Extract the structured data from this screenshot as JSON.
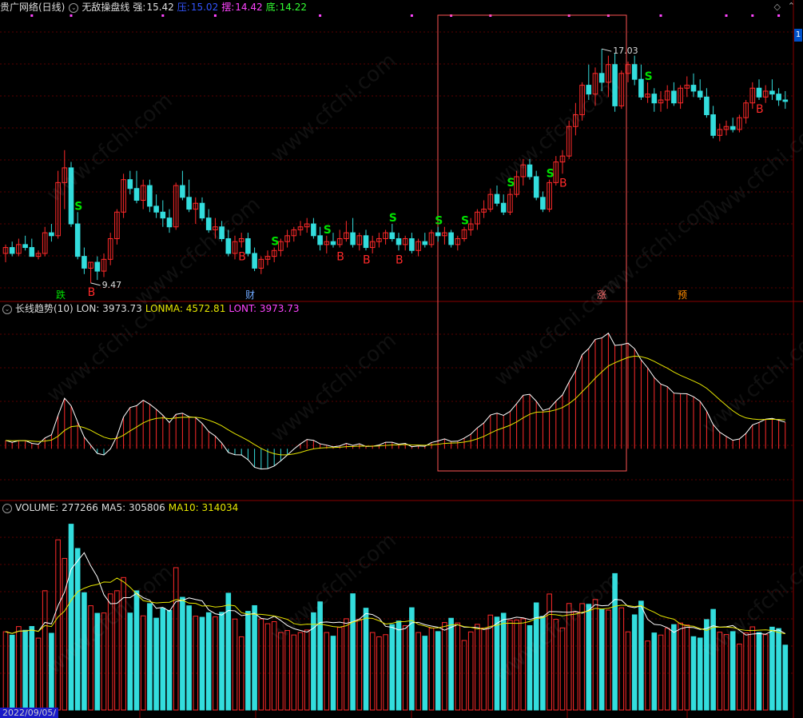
{
  "main_header": {
    "app": "贵广网络(日线)",
    "indicator": "无敌操盘线",
    "strong_label": "强:",
    "strong_value": "15.42",
    "press_label": "压:",
    "press_value": "15.02",
    "swing_label": "摆:",
    "swing_value": "14.42",
    "bottom_label": "底:",
    "bottom_value": "14.22"
  },
  "trend_header": {
    "name": "长线趋势(10)",
    "lon": "LON: 3973.73",
    "lonma": "LONMA: 4572.81",
    "lont": "LONT: 3973.73"
  },
  "volume_header": {
    "name": "VOLUME: 277266",
    "ma5": "MA5: 305806",
    "ma10": "MA10: 314034"
  },
  "date_label": "2022/09/05/",
  "page_indicator": "1",
  "colors": {
    "up": "#ff2a2a",
    "down": "#33dddd",
    "signal_s": "#00e000",
    "signal_b": "#ff2a2a",
    "ma_white": "#ffffff",
    "ma_yellow": "#e6e600",
    "lont": "#ff44ff",
    "press": "#3355ff",
    "grid": "#5a0000"
  },
  "watermark_text": "www.cfchi.com",
  "chart_data": {
    "type": "candlestick",
    "price": {
      "ylim": [
        8.5,
        18.2
      ],
      "ohlc": [
        [
          10.1,
          10.4,
          9.8,
          10.3
        ],
        [
          10.3,
          10.5,
          10.0,
          10.1
        ],
        [
          10.1,
          10.6,
          10.0,
          10.4
        ],
        [
          10.4,
          10.7,
          10.2,
          10.3
        ],
        [
          10.3,
          10.6,
          10.1,
          10.0
        ],
        [
          10.0,
          10.2,
          9.9,
          10.1
        ],
        [
          10.1,
          11.0,
          10.0,
          10.8
        ],
        [
          10.8,
          11.1,
          10.5,
          10.7
        ],
        [
          10.7,
          12.9,
          10.6,
          12.5
        ],
        [
          12.5,
          13.6,
          11.6,
          13.0
        ],
        [
          13.0,
          13.2,
          11.0,
          11.1
        ],
        [
          11.1,
          11.5,
          9.9,
          10.0
        ],
        [
          10.0,
          10.3,
          9.4,
          9.6
        ],
        [
          9.6,
          9.8,
          9.1,
          9.8
        ],
        [
          9.8,
          10.0,
          9.2,
          9.5
        ],
        [
          9.5,
          10.1,
          9.3,
          9.9
        ],
        [
          9.9,
          10.8,
          9.7,
          10.6
        ],
        [
          10.6,
          11.6,
          10.4,
          11.5
        ],
        [
          11.5,
          12.8,
          11.3,
          12.6
        ],
        [
          12.6,
          12.9,
          12.1,
          12.3
        ],
        [
          12.3,
          12.9,
          11.8,
          11.9
        ],
        [
          11.9,
          12.6,
          11.6,
          12.4
        ],
        [
          12.4,
          12.6,
          11.5,
          11.7
        ],
        [
          11.7,
          12.1,
          11.3,
          11.5
        ],
        [
          11.5,
          11.9,
          11.0,
          11.3
        ],
        [
          11.3,
          11.6,
          10.8,
          11.0
        ],
        [
          11.0,
          12.5,
          10.9,
          12.4
        ],
        [
          12.4,
          12.9,
          11.9,
          12.0
        ],
        [
          12.0,
          12.6,
          11.5,
          11.6
        ],
        [
          11.6,
          12.0,
          11.1,
          11.8
        ],
        [
          11.8,
          12.0,
          11.2,
          11.3
        ],
        [
          11.3,
          11.6,
          10.8,
          10.9
        ],
        [
          10.9,
          11.3,
          10.6,
          11.0
        ],
        [
          11.0,
          11.2,
          10.5,
          10.6
        ],
        [
          10.6,
          10.9,
          10.0,
          10.1
        ],
        [
          10.1,
          10.7,
          9.9,
          10.5
        ],
        [
          10.5,
          10.8,
          10.3,
          10.6
        ],
        [
          10.6,
          10.8,
          10.0,
          10.1
        ],
        [
          10.1,
          10.3,
          9.5,
          9.6
        ],
        [
          9.6,
          10.0,
          9.4,
          9.9
        ],
        [
          9.9,
          10.2,
          9.7,
          10.0
        ],
        [
          10.0,
          10.3,
          9.8,
          10.2
        ],
        [
          10.2,
          10.6,
          10.0,
          10.5
        ],
        [
          10.5,
          10.9,
          10.3,
          10.7
        ],
        [
          10.7,
          11.0,
          10.5,
          10.9
        ],
        [
          10.9,
          11.2,
          10.7,
          11.0
        ],
        [
          11.0,
          11.3,
          10.8,
          11.1
        ],
        [
          11.1,
          11.3,
          10.6,
          10.7
        ],
        [
          10.7,
          11.0,
          10.2,
          10.4
        ],
        [
          10.4,
          10.7,
          10.1,
          10.5
        ],
        [
          10.5,
          10.8,
          10.3,
          10.4
        ],
        [
          10.4,
          10.9,
          10.3,
          10.6
        ],
        [
          10.6,
          11.2,
          10.5,
          10.8
        ],
        [
          10.8,
          11.3,
          10.3,
          10.4
        ],
        [
          10.4,
          10.8,
          10.2,
          10.7
        ],
        [
          10.7,
          10.9,
          10.2,
          10.3
        ],
        [
          10.3,
          10.7,
          10.1,
          10.5
        ],
        [
          10.5,
          10.8,
          10.3,
          10.6
        ],
        [
          10.6,
          10.9,
          10.4,
          10.8
        ],
        [
          10.8,
          11.1,
          10.5,
          10.6
        ],
        [
          10.6,
          10.8,
          10.2,
          10.4
        ],
        [
          10.4,
          10.7,
          10.2,
          10.6
        ],
        [
          10.6,
          10.8,
          10.1,
          10.2
        ],
        [
          10.2,
          10.6,
          10.0,
          10.5
        ],
        [
          10.5,
          10.8,
          10.3,
          10.4
        ],
        [
          10.4,
          10.9,
          10.3,
          10.8
        ],
        [
          10.8,
          11.0,
          10.5,
          10.7
        ],
        [
          10.7,
          11.0,
          10.4,
          10.8
        ],
        [
          10.8,
          10.9,
          10.3,
          10.4
        ],
        [
          10.4,
          10.7,
          10.2,
          10.6
        ],
        [
          10.6,
          11.0,
          10.5,
          10.9
        ],
        [
          10.9,
          11.3,
          10.7,
          11.1
        ],
        [
          11.1,
          11.6,
          10.9,
          11.5
        ],
        [
          11.5,
          11.9,
          11.3,
          11.6
        ],
        [
          11.6,
          12.3,
          11.5,
          12.1
        ],
        [
          12.1,
          12.4,
          11.7,
          11.8
        ],
        [
          11.8,
          12.1,
          11.4,
          11.5
        ],
        [
          11.5,
          12.3,
          11.4,
          12.1
        ],
        [
          12.1,
          12.9,
          12.0,
          12.7
        ],
        [
          12.7,
          13.3,
          12.4,
          13.1
        ],
        [
          13.1,
          13.3,
          12.6,
          12.7
        ],
        [
          12.7,
          12.9,
          11.9,
          12.0
        ],
        [
          12.0,
          12.2,
          11.5,
          11.6
        ],
        [
          11.6,
          12.6,
          11.5,
          12.5
        ],
        [
          12.5,
          13.4,
          12.4,
          13.2
        ],
        [
          13.2,
          13.6,
          12.8,
          13.4
        ],
        [
          13.4,
          14.6,
          13.3,
          14.4
        ],
        [
          14.4,
          15.2,
          14.1,
          14.8
        ],
        [
          14.8,
          15.9,
          14.6,
          15.8
        ],
        [
          15.8,
          16.5,
          15.3,
          15.5
        ],
        [
          15.5,
          16.4,
          15.1,
          16.2
        ],
        [
          16.2,
          17.03,
          15.6,
          15.9
        ],
        [
          15.9,
          16.8,
          15.4,
          16.5
        ],
        [
          16.5,
          16.9,
          14.9,
          15.1
        ],
        [
          15.1,
          16.3,
          15.0,
          16.2
        ],
        [
          16.2,
          16.6,
          15.9,
          16.5
        ],
        [
          16.5,
          16.8,
          15.8,
          16.0
        ],
        [
          16.0,
          16.5,
          15.3,
          15.4
        ],
        [
          15.4,
          15.9,
          15.2,
          15.5
        ],
        [
          15.5,
          15.7,
          14.9,
          15.2
        ],
        [
          15.2,
          15.6,
          14.9,
          15.3
        ],
        [
          15.3,
          15.8,
          15.0,
          15.6
        ],
        [
          15.6,
          15.9,
          15.1,
          15.2
        ],
        [
          15.2,
          15.8,
          15.0,
          15.7
        ],
        [
          15.7,
          16.1,
          15.4,
          15.8
        ],
        [
          15.8,
          16.2,
          15.4,
          15.6
        ],
        [
          15.6,
          16.0,
          15.3,
          15.4
        ],
        [
          15.4,
          15.7,
          14.7,
          14.8
        ],
        [
          14.8,
          15.1,
          14.0,
          14.1
        ],
        [
          14.1,
          14.5,
          13.9,
          14.3
        ],
        [
          14.3,
          14.6,
          14.1,
          14.4
        ],
        [
          14.4,
          14.7,
          14.2,
          14.3
        ],
        [
          14.3,
          14.8,
          14.2,
          14.7
        ],
        [
          14.7,
          15.3,
          14.5,
          15.2
        ],
        [
          15.2,
          15.9,
          15.0,
          15.7
        ],
        [
          15.7,
          16.0,
          15.3,
          15.4
        ],
        [
          15.4,
          15.8,
          15.2,
          15.6
        ],
        [
          15.6,
          16.0,
          15.3,
          15.5
        ],
        [
          15.5,
          15.7,
          15.1,
          15.3
        ],
        [
          15.3,
          15.6,
          15.0,
          15.25
        ]
      ],
      "hl_labels": [
        "17.03",
        "9.47"
      ],
      "signals_s": [
        11,
        41,
        49,
        59,
        66,
        70,
        77,
        83,
        98
      ],
      "signals_b": [
        13,
        36,
        51,
        55,
        60,
        85,
        115
      ]
    },
    "event_labels": [
      "跌",
      "财",
      "涨",
      "预"
    ],
    "trend": {
      "ylim": [
        -3000,
        8000
      ]
    }
  }
}
